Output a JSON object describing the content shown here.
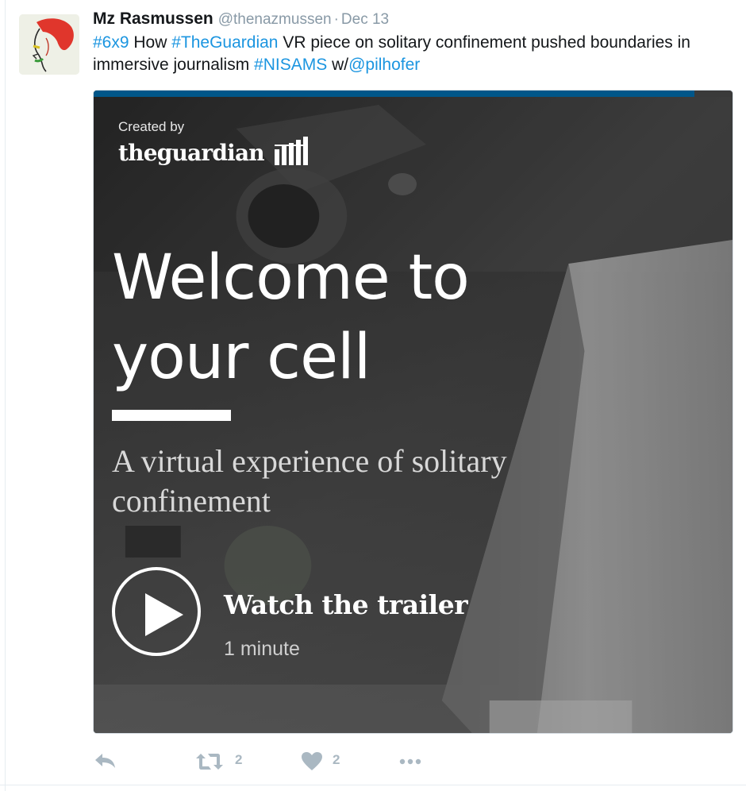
{
  "tweet": {
    "author_name": "Mz Rasmussen",
    "author_handle": "@thenazmussen",
    "separator": "·",
    "date": "Dec 13",
    "text_parts": [
      {
        "text": "#6x9",
        "link": true
      },
      {
        "text": " How ",
        "link": false
      },
      {
        "text": "#TheGuardian",
        "link": true
      },
      {
        "text": " VR piece on solitary confinement pushed boundaries in immersive journalism ",
        "link": false
      },
      {
        "text": "#NISAMS",
        "link": true
      },
      {
        "text": " w/",
        "link": false
      },
      {
        "text": "@pilhofer",
        "link": true
      }
    ]
  },
  "media": {
    "created_by": "Created by",
    "brand": "theguardian",
    "headline_line1": "Welcome to",
    "headline_line2": "your cell",
    "subtitle_line1": "A virtual experience of solitary",
    "subtitle_line2": "confinement",
    "cta": "Watch the trailer",
    "duration": "1 minute",
    "progress": 0.94
  },
  "actions": {
    "reply_icon": "reply-icon",
    "retweet_icon": "retweet-icon",
    "retweet_count": "2",
    "like_icon": "heart-icon",
    "like_count": "2",
    "more_icon": "more-icon"
  },
  "colors": {
    "link": "#1b95e0",
    "muted": "#8899a6",
    "action_gray": "#aab8c2",
    "guardian_blue": "#005689"
  }
}
